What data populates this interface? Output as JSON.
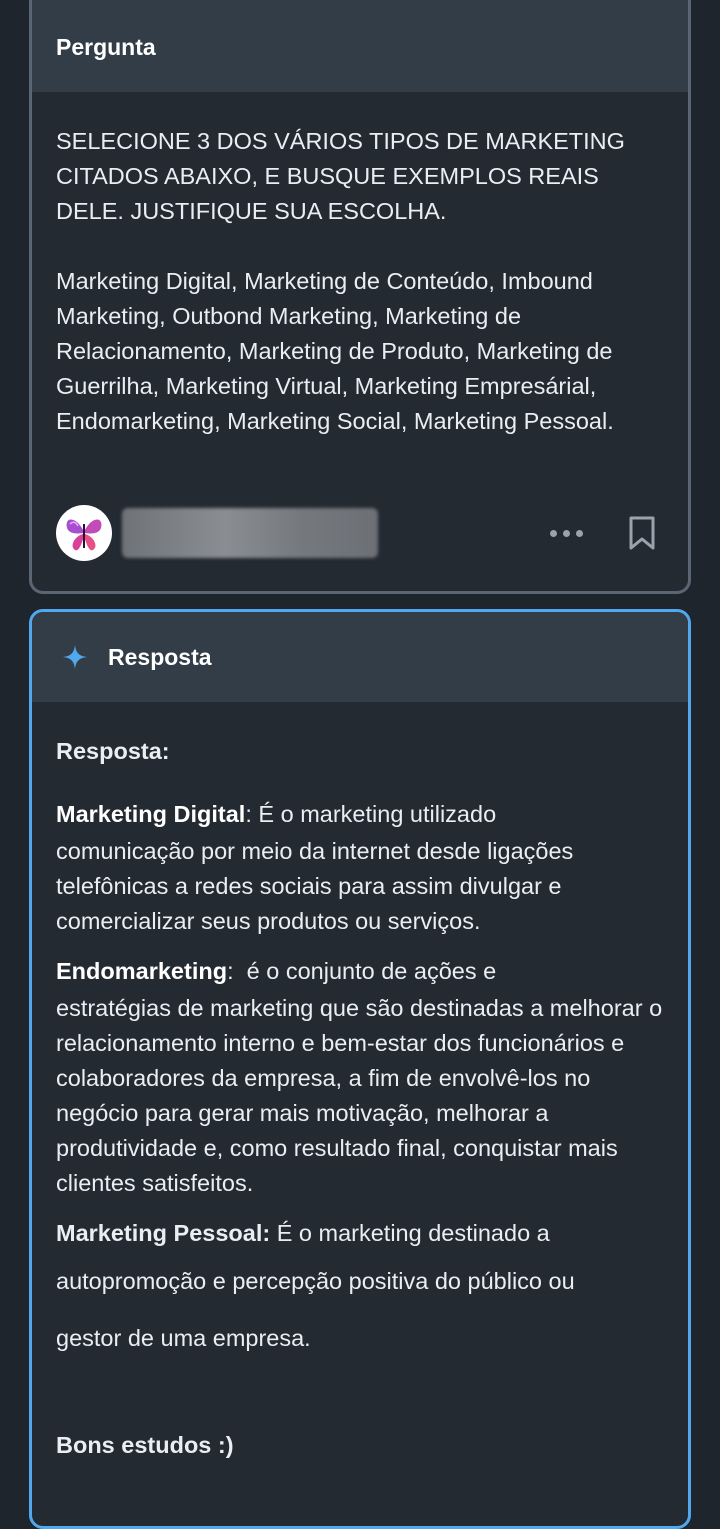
{
  "question": {
    "header": "Pergunta",
    "paragraph1": "SELECIONE 3 DOS VÁRIOS TIPOS DE MARKETING CITADOS ABAIXO, E BUSQUE EXEMPLOS REAIS DELE. JUSTIFIQUE SUA ESCOLHA.",
    "paragraph2": "Marketing Digital, Marketing de Conteúdo, Imbound Marketing, Outbond Marketing, Marketing de Relacionamento, Marketing de Produto, Marketing de Guerrilha, Marketing Virtual, Marketing Empresárial, Endomarketing, Marketing Social, Marketing Pessoal.",
    "avatar_icon": "butterfly-icon",
    "more_icon": "more-dots-icon",
    "bookmark_icon": "bookmark-icon"
  },
  "answer": {
    "header": "Resposta",
    "header_icon": "sparkle-icon",
    "title": "Resposta:",
    "items": [
      {
        "term": "Marketing Digital",
        "sep": ": ",
        "lead": "É o marketing utilizado",
        "rest": "comunicação por meio da internet desde ligações telefônicas a redes sociais para assim divulgar e comercializar seus produtos ou serviços."
      },
      {
        "term": "Endomarketing",
        "sep": ":  ",
        "lead": "é o conjunto de ações e",
        "rest": "estratégias de marketing que são destinadas a melhorar o relacionamento interno e bem-estar dos funcionários e colaboradores da empresa, a fim de envolvê-los no negócio para gerar mais motivação, melhorar a produtividade e, como resultado final, conquistar mais clientes satisfeitos."
      }
    ],
    "pessoal": {
      "term": "Marketing Pessoal:",
      "lead": " É o marketing destinado a",
      "line2": "autopromoção e percepção positiva do público ou",
      "line3": "gestor de uma empresa."
    },
    "closing": "Bons estudos :)"
  },
  "colors": {
    "background": "#1f252c",
    "card": "#242a32",
    "header": "#333d47",
    "accent": "#4fa9ec",
    "question_border": "#5a6673"
  }
}
